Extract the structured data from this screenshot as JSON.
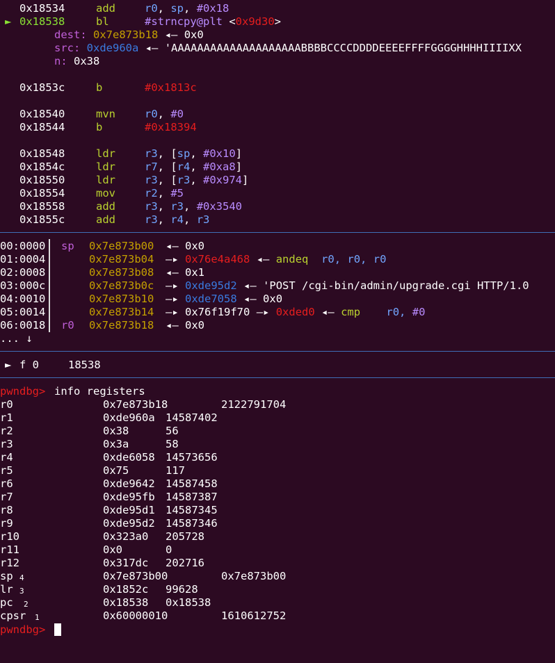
{
  "colors": {
    "background": "#2c0a22",
    "text": "#ffffff",
    "address": "#ffffff",
    "mnemonic": "#b9d12f",
    "register": "#72a6ff",
    "immediate": "#b98cff",
    "red": "#e61e1e",
    "highlight_green": "#8ae234",
    "stack_addr": "#c4a000",
    "arg_label": "#c05fd8",
    "heap_addr": "#3a7be0",
    "separator": "#3f6fb8"
  },
  "disasm": {
    "l1": {
      "addr": "0x18534",
      "op": "add",
      "reg1": "r0",
      "reg2": "sp",
      "imm": "#0x18"
    },
    "l2": {
      "marker": "►",
      "addr": "0x18538",
      "op": "bl",
      "target": "#strncpy@plt",
      "lt": "<",
      "target_addr": "0x9d30",
      "gt": ">"
    },
    "arg_dest": {
      "label": "dest:",
      "value": "0x7e873b18",
      "arrow": "◂—",
      "deref": "0x0"
    },
    "arg_src": {
      "label": "src:",
      "value": "0xde960a",
      "arrow": "◂—",
      "deref": "'AAAAAAAAAAAAAAAAAAAABBBBCCCCDDDDEEEEFFFFGGGGHHHHIIIIXX"
    },
    "arg_n": {
      "label": "n:",
      "value": "0x38"
    },
    "l3": {
      "addr": "0x1853c",
      "op": "b",
      "target": "#0x1813c"
    },
    "l4": {
      "addr": "0x18540",
      "op": "mvn",
      "reg1": "r0",
      "imm": "#0"
    },
    "l5": {
      "addr": "0x18544",
      "op": "b",
      "target": "#0x18394"
    },
    "l6": {
      "addr": "0x18548",
      "op": "ldr",
      "reg1": "r3",
      "mem_reg": "sp",
      "imm": "#0x10"
    },
    "l7": {
      "addr": "0x1854c",
      "op": "ldr",
      "reg1": "r7",
      "mem_reg": "r4",
      "imm": "#0xa8"
    },
    "l8": {
      "addr": "0x18550",
      "op": "ldr",
      "reg1": "r3",
      "mem_reg": "r3",
      "imm": "#0x974"
    },
    "l9": {
      "addr": "0x18554",
      "op": "mov",
      "reg1": "r2",
      "imm": "#5"
    },
    "l10": {
      "addr": "0x18558",
      "op": "add",
      "reg1": "r3",
      "reg2": "r3",
      "imm": "#0x3540"
    },
    "l11": {
      "addr": "0x1855c",
      "op": "add",
      "reg1": "r3",
      "reg2": "r4",
      "reg3": "r3"
    }
  },
  "stack": [
    {
      "off": "00:0000",
      "reg": "sp",
      "addr": "0x7e873b00",
      "chain": [
        "◂—",
        "0x0"
      ]
    },
    {
      "off": "01:0004",
      "reg": "",
      "addr": "0x7e873b04",
      "chain": [
        "—▸",
        "0x76e4a468",
        "◂—",
        "andeq",
        "r0,",
        "r0,",
        "r0"
      ]
    },
    {
      "off": "02:0008",
      "reg": "",
      "addr": "0x7e873b08",
      "chain": [
        "◂—",
        "0x1"
      ]
    },
    {
      "off": "03:000c",
      "reg": "",
      "addr": "0x7e873b0c",
      "chain": [
        "—▸",
        "0xde95d2",
        "◂—",
        "'POST /cgi-bin/admin/upgrade.cgi HTTP/1.0"
      ]
    },
    {
      "off": "04:0010",
      "reg": "",
      "addr": "0x7e873b10",
      "chain": [
        "—▸",
        "0xde7058",
        "◂—",
        "0x0"
      ]
    },
    {
      "off": "05:0014",
      "reg": "",
      "addr": "0x7e873b14",
      "chain": [
        "—▸",
        "0x76f19f70",
        "—▸",
        "0xded0",
        "◂—",
        "cmp",
        "r0,",
        "#0"
      ]
    },
    {
      "off": "06:0018",
      "reg": "r0",
      "addr": "0x7e873b18",
      "chain": [
        "◂—",
        "0x0"
      ]
    }
  ],
  "stack_more": "... ↓",
  "backtrace": {
    "marker": "►",
    "frame": "f 0",
    "addr": "18538"
  },
  "prompt": "pwndbg>",
  "command": "info registers",
  "registers": [
    {
      "name": "r0",
      "hex": "0x7e873b18",
      "val": "2122791704"
    },
    {
      "name": "r1",
      "hex": "0xde960a",
      "val": "14587402"
    },
    {
      "name": "r2",
      "hex": "0x38",
      "val": "56"
    },
    {
      "name": "r3",
      "hex": "0x3a",
      "val": "58"
    },
    {
      "name": "r4",
      "hex": "0xde6058",
      "val": "14573656"
    },
    {
      "name": "r5",
      "hex": "0x75",
      "val": "117"
    },
    {
      "name": "r6",
      "hex": "0xde9642",
      "val": "14587458"
    },
    {
      "name": "r7",
      "hex": "0xde95fb",
      "val": "14587387"
    },
    {
      "name": "r8",
      "hex": "0xde95d1",
      "val": "14587345"
    },
    {
      "name": "r9",
      "hex": "0xde95d2",
      "val": "14587346"
    },
    {
      "name": "r10",
      "hex": "0x323a0",
      "val": "205728"
    },
    {
      "name": "r11",
      "hex": "0x0",
      "val": "0"
    },
    {
      "name": "r12",
      "hex": "0x317dc",
      "val": "202716"
    },
    {
      "name": "sp",
      "hex": "0x7e873b00",
      "val": "0x7e873b00",
      "note": "4"
    },
    {
      "name": "lr",
      "hex": "0x1852c",
      "val": "99628",
      "note": "3"
    },
    {
      "name": "pc",
      "hex": "0x18538",
      "val": "0x18538",
      "note": "2"
    },
    {
      "name": "cpsr",
      "hex": "0x60000010",
      "val": "1610612752",
      "note": "1"
    }
  ]
}
